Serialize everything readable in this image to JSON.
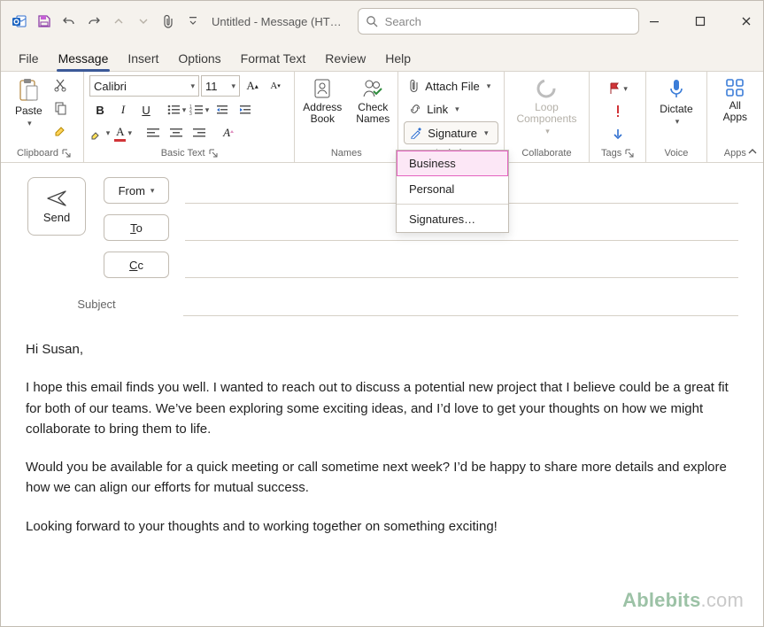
{
  "titlebar": {
    "app_title": "Untitled - Message (HT…",
    "search_placeholder": "Search"
  },
  "tabs": {
    "file": "File",
    "message": "Message",
    "insert": "Insert",
    "options": "Options",
    "format_text": "Format Text",
    "review": "Review",
    "help": "Help"
  },
  "ribbon": {
    "clipboard": {
      "label": "Clipboard",
      "paste": "Paste"
    },
    "basic_text": {
      "label": "Basic Text",
      "font_name": "Calibri",
      "font_size": "11"
    },
    "names": {
      "label": "Names",
      "address_book": "Address\nBook",
      "check_names": "Check\nNames"
    },
    "include": {
      "label": "Include",
      "attach_file": "Attach File",
      "link": "Link",
      "signature": "Signature",
      "menu": {
        "business": "Business",
        "personal": "Personal",
        "signatures": "Signatures…"
      }
    },
    "collaborate": {
      "label": "Collaborate",
      "loop": "Loop\nComponents"
    },
    "tags": {
      "label": "Tags"
    },
    "voice": {
      "label": "Voice",
      "dictate": "Dictate"
    },
    "apps": {
      "label": "Apps",
      "all_apps": "All\nApps"
    }
  },
  "compose": {
    "send": "Send",
    "from": "From",
    "to_prefix": "T",
    "to_suffix": "o",
    "cc_prefix": "C",
    "cc_suffix": "c",
    "subject_label": "Subject"
  },
  "body": {
    "p1": "Hi Susan,",
    "p2": "I hope this email finds you well. I wanted to reach out to discuss a potential new project that I believe could be a great fit for both of our teams. We’ve been exploring some exciting ideas, and I’d love to get your thoughts on how we might collaborate to bring them to life.",
    "p3": "Would you be available for a quick meeting or call sometime next week? I’d be happy to share more details and explore how we can align our efforts for mutual success.",
    "p4": "Looking forward to your thoughts and to working together on something exciting!"
  },
  "watermark": {
    "brand": "Ablebits",
    "suffix": ".com"
  }
}
